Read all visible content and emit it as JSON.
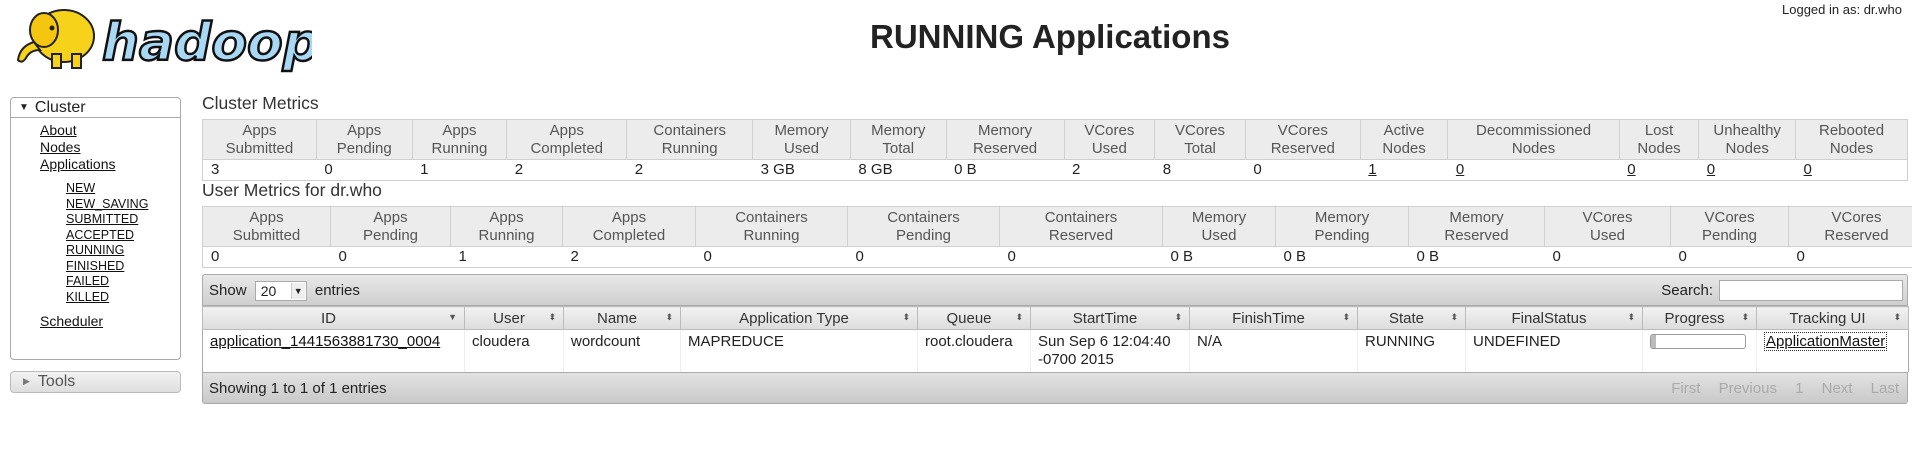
{
  "header": {
    "logo_text": "hadoop",
    "title": "RUNNING Applications",
    "logged_in": "Logged in as: dr.who"
  },
  "nav": {
    "cluster_label": "Cluster",
    "links": [
      "About",
      "Nodes",
      "Applications"
    ],
    "app_states": [
      "NEW",
      "NEW_SAVING",
      "SUBMITTED",
      "ACCEPTED",
      "RUNNING",
      "FINISHED",
      "FAILED",
      "KILLED"
    ],
    "scheduler_label": "Scheduler",
    "tools_label": "Tools"
  },
  "cluster_metrics": {
    "title": "Cluster Metrics",
    "headers": [
      [
        "Apps",
        "Submitted"
      ],
      [
        "Apps",
        "Pending"
      ],
      [
        "Apps",
        "Running"
      ],
      [
        "Apps",
        "Completed"
      ],
      [
        "Containers",
        "Running"
      ],
      [
        "Memory",
        "Used"
      ],
      [
        "Memory",
        "Total"
      ],
      [
        "Memory",
        "Reserved"
      ],
      [
        "VCores",
        "Used"
      ],
      [
        "VCores",
        "Total"
      ],
      [
        "VCores",
        "Reserved"
      ],
      [
        "Active",
        "Nodes"
      ],
      [
        "Decommissioned",
        "Nodes"
      ],
      [
        "Lost",
        "Nodes"
      ],
      [
        "Unhealthy",
        "Nodes"
      ],
      [
        "Rebooted",
        "Nodes"
      ]
    ],
    "values": [
      "3",
      "0",
      "1",
      "2",
      "2",
      "3 GB",
      "8 GB",
      "0 B",
      "2",
      "8",
      "0",
      "1",
      "0",
      "0",
      "0",
      "0"
    ]
  },
  "user_metrics": {
    "title": "User Metrics for dr.who",
    "headers": [
      [
        "Apps",
        "Submitted"
      ],
      [
        "Apps",
        "Pending"
      ],
      [
        "Apps",
        "Running"
      ],
      [
        "Apps",
        "Completed"
      ],
      [
        "Containers",
        "Running"
      ],
      [
        "Containers",
        "Pending"
      ],
      [
        "Containers",
        "Reserved"
      ],
      [
        "Memory",
        "Used"
      ],
      [
        "Memory",
        "Pending"
      ],
      [
        "Memory",
        "Reserved"
      ],
      [
        "VCores",
        "Used"
      ],
      [
        "VCores",
        "Pending"
      ],
      [
        "VCores",
        "Reserved"
      ]
    ],
    "values": [
      "0",
      "0",
      "1",
      "2",
      "0",
      "0",
      "0",
      "0 B",
      "0 B",
      "0 B",
      "0",
      "0",
      "0"
    ]
  },
  "apps_table": {
    "show_label": "Show",
    "page_length": "20",
    "entries_label": "entries",
    "search_label": "Search:",
    "search_value": "",
    "columns": [
      "ID",
      "User",
      "Name",
      "Application Type",
      "Queue",
      "StartTime",
      "FinishTime",
      "State",
      "FinalStatus",
      "Progress",
      "Tracking UI"
    ],
    "rows": [
      {
        "id": "application_1441563881730_0004",
        "user": "cloudera",
        "name": "wordcount",
        "type": "MAPREDUCE",
        "queue": "root.cloudera",
        "start": "Sun Sep 6 12:04:40 -0700 2015",
        "finish": "N/A",
        "state": "RUNNING",
        "final_status": "UNDEFINED",
        "progress": 5,
        "tracking": "ApplicationMaster"
      }
    ],
    "footer_info": "Showing 1 to 1 of 1 entries",
    "paginate": [
      "First",
      "Previous",
      "1",
      "Next",
      "Last"
    ]
  },
  "colors": {
    "logo_blue": "#a9d8f5",
    "logo_yellow": "#f7d21b",
    "header_bg": "#ececec"
  }
}
